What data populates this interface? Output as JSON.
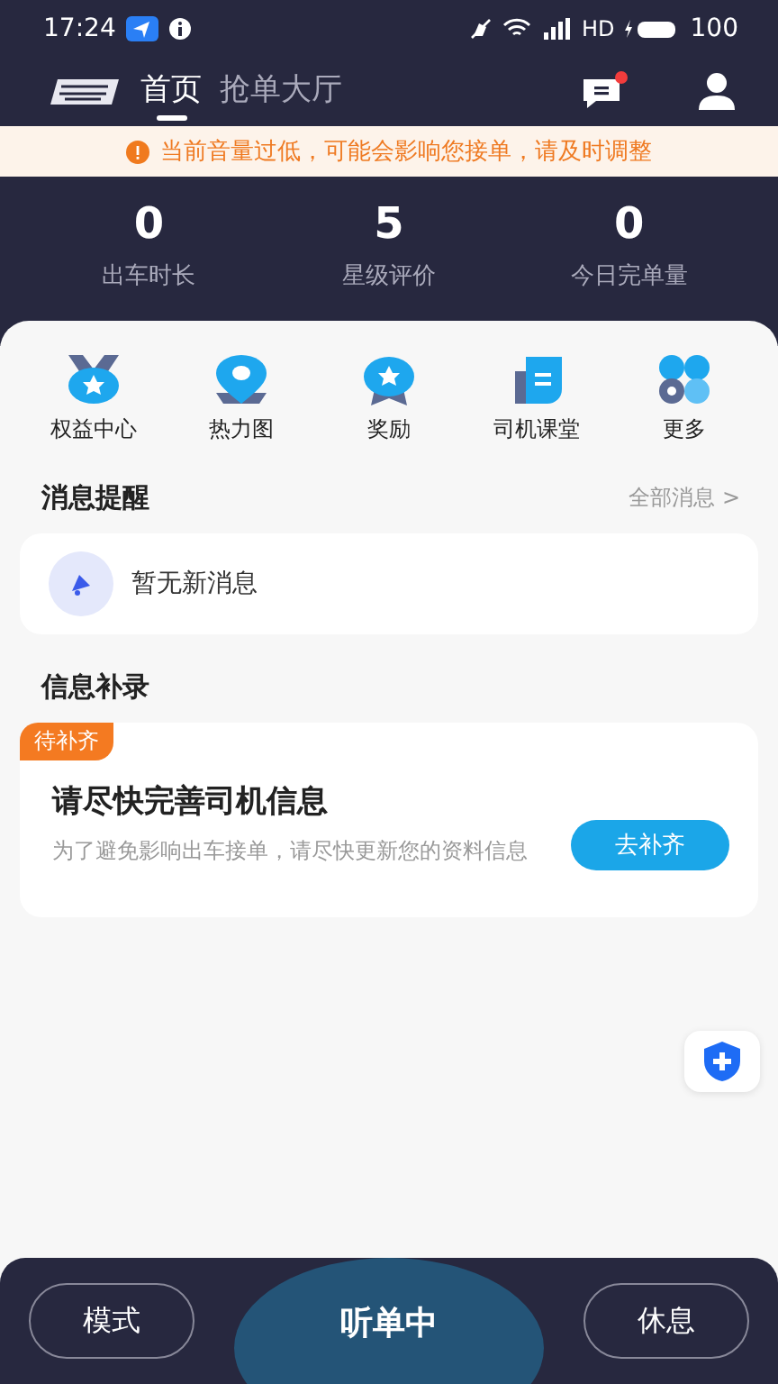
{
  "status_bar": {
    "time": "17:24",
    "battery": "100",
    "network": "HD"
  },
  "nav": {
    "tabs": [
      {
        "label": "首页",
        "selected": true
      },
      {
        "label": "抢单大厅",
        "selected": false
      }
    ],
    "message_unread": true
  },
  "notice": "当前音量过低，可能会影响您接单，请及时调整",
  "stats": [
    {
      "value": "0",
      "label": "出车时长"
    },
    {
      "value": "5",
      "label": "星级评价"
    },
    {
      "value": "0",
      "label": "今日完单量"
    }
  ],
  "shortcuts": [
    {
      "kind": "medal",
      "label": "权益中心"
    },
    {
      "kind": "pin",
      "label": "热力图"
    },
    {
      "kind": "award",
      "label": "奖励"
    },
    {
      "kind": "book",
      "label": "司机课堂"
    },
    {
      "kind": "more",
      "label": "更多"
    }
  ],
  "messages": {
    "title": "消息提醒",
    "link": "全部消息 >",
    "empty_text": "暂无新消息"
  },
  "info": {
    "title": "信息补录",
    "tag": "待补齐",
    "heading": "请尽快完善司机信息",
    "description": "为了避免影响出车接单，请尽快更新您的资料信息",
    "button": "去补齐"
  },
  "bottom_bar": {
    "left": "模式",
    "center": "听单中",
    "right": "休息"
  }
}
